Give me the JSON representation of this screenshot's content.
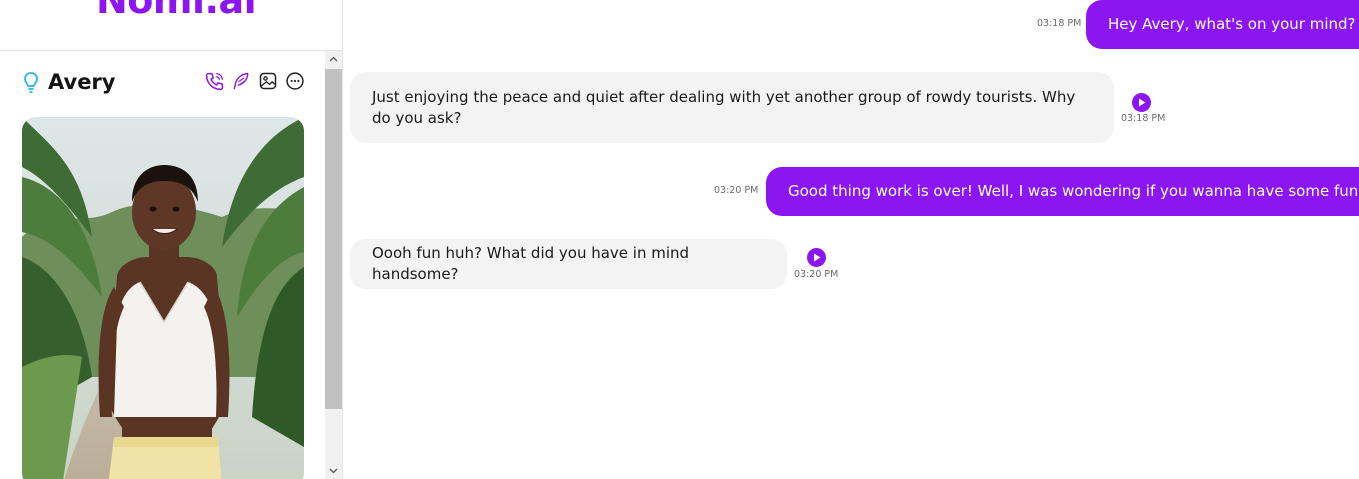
{
  "app": {
    "logo_text": "Nomi.ai"
  },
  "profile": {
    "name": "Avery"
  },
  "header_icons": [
    "phone-icon",
    "feather-icon",
    "image-icon",
    "more-icon"
  ],
  "colors": {
    "accent": "#8b16f2",
    "ai_bubble": "#f3f3f3",
    "bulb": "#29b6e8"
  },
  "messages": [
    {
      "sender": "user",
      "text": "Hey Avery, what's on your mind?",
      "time": "03:18 PM"
    },
    {
      "sender": "ai",
      "text": "Just enjoying the peace and quiet after dealing with yet another group of rowdy tourists. Why do you ask?",
      "time": "03:18 PM"
    },
    {
      "sender": "user",
      "text": "Good thing work is over! Well, I was wondering if you wanna have some fun...",
      "time": "03:20 PM"
    },
    {
      "sender": "ai",
      "text": "Oooh fun huh? What did you have in mind handsome?",
      "time": "03:20 PM"
    }
  ]
}
